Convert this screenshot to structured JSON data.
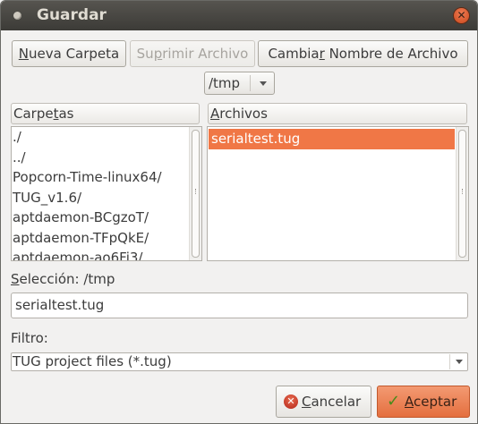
{
  "window": {
    "title": "Guardar"
  },
  "toolbar": {
    "new_folder": {
      "pre": "",
      "u": "N",
      "post": "ueva Carpeta"
    },
    "delete_file": {
      "pre": "Su",
      "u": "p",
      "post": "rimir Archivo"
    },
    "rename_file": {
      "pre": "Cambia",
      "u": "r",
      "post": " Nombre de Archivo"
    }
  },
  "path": {
    "value": "/tmp"
  },
  "folders": {
    "header": {
      "pre": "Carpe",
      "u": "t",
      "post": "as"
    },
    "items": [
      "./",
      "../",
      "Popcorn-Time-linux64/",
      "TUG_v1.6/",
      "aptdaemon-BCgzoT/",
      "aptdaemon-TFpQkE/",
      "aptdaemon-ao6Fi3/"
    ]
  },
  "files": {
    "header": {
      "pre": "",
      "u": "A",
      "post": "rchivos"
    },
    "items": [
      "serialtest.tug"
    ],
    "selected_index": 0
  },
  "selection": {
    "label_pre": "",
    "label_u": "S",
    "label_post": "elección: /tmp",
    "value": "serialtest.tug"
  },
  "filter": {
    "label": "Filtro:",
    "value": "TUG project files (*.tug)"
  },
  "actions": {
    "cancel": {
      "pre": "",
      "u": "C",
      "post": "ancelar"
    },
    "accept": {
      "pre": "",
      "u": "A",
      "post": "ceptar"
    }
  },
  "colors": {
    "accent": "#f07746",
    "titlebar": "#3c3b37"
  }
}
